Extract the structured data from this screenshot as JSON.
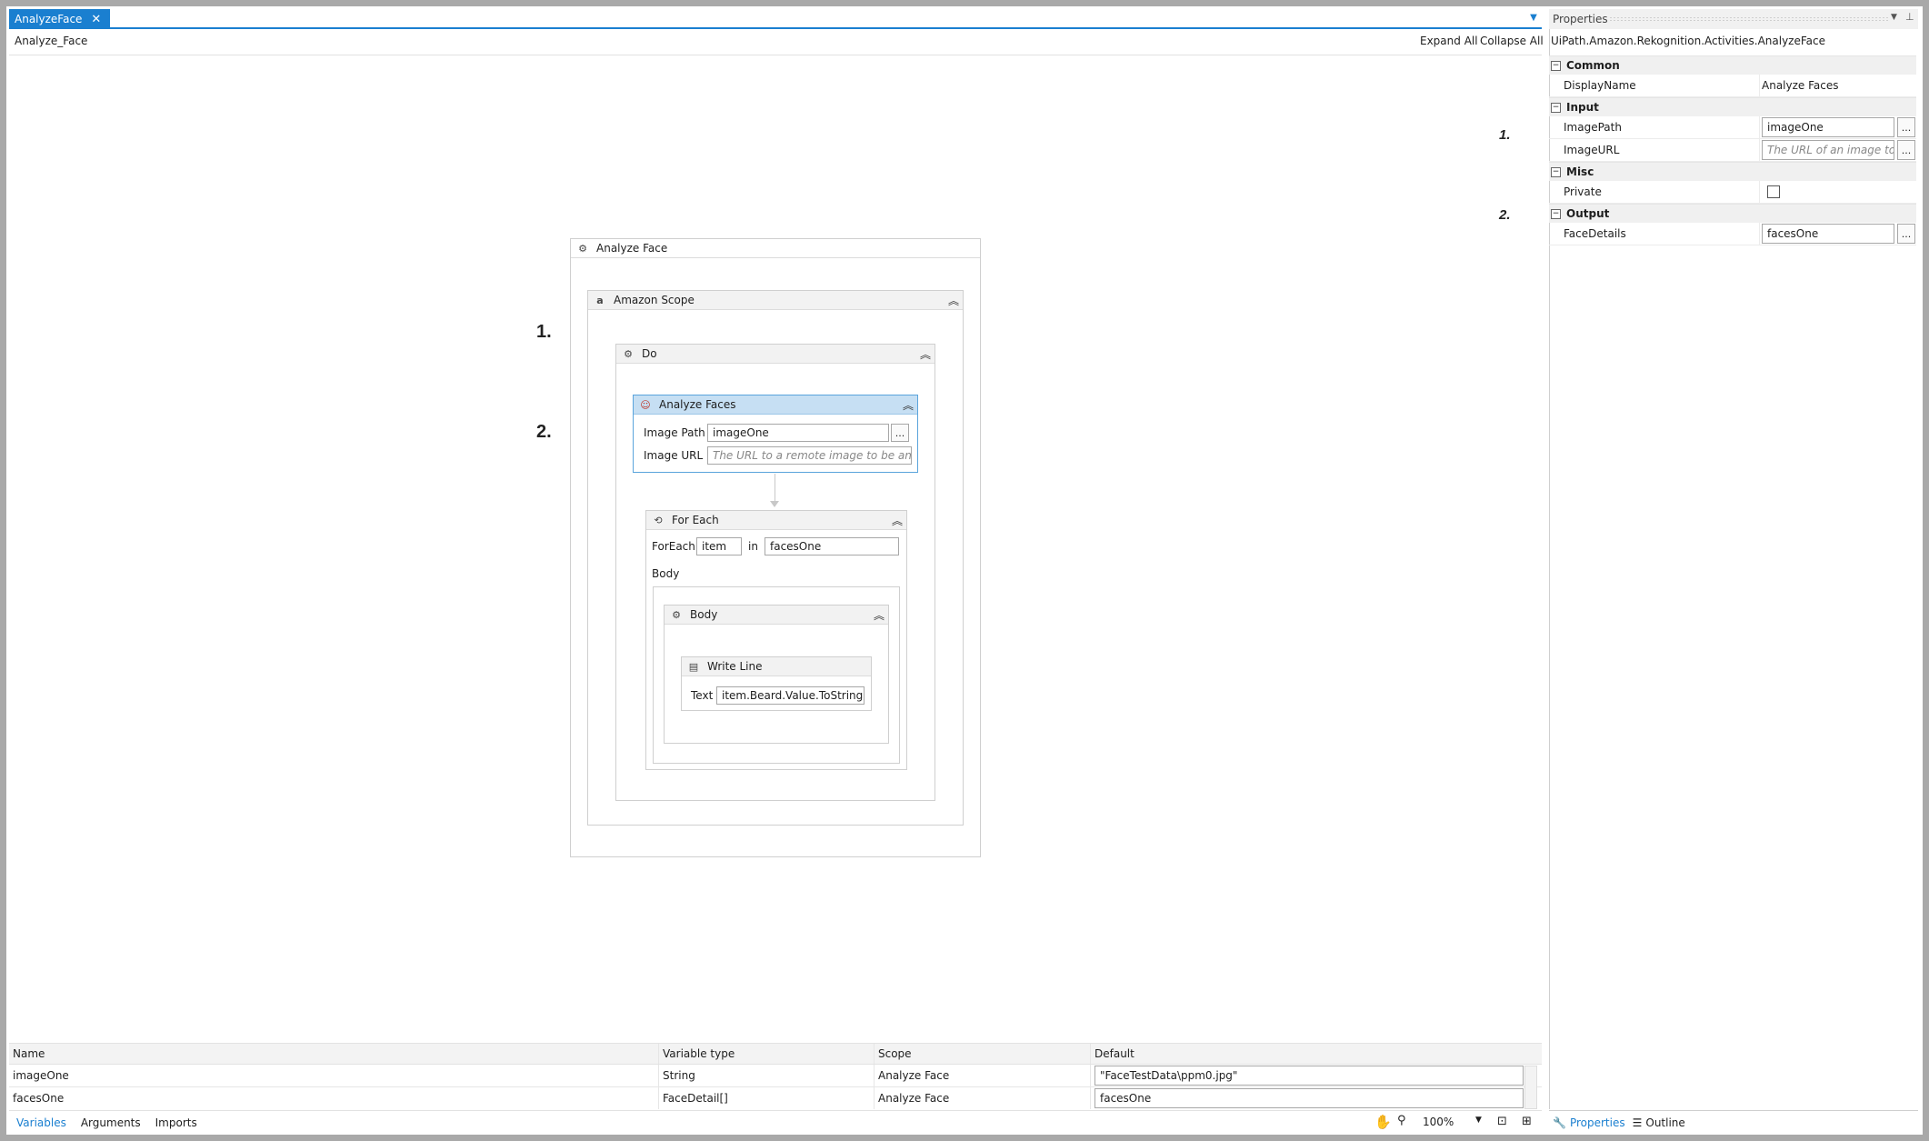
{
  "document": {
    "tab_title": "AnalyzeFace",
    "close_glyph": "✕",
    "breadcrumb": "Analyze_Face",
    "expand_all": "Expand All",
    "collapse_all": "Collapse All"
  },
  "markers": {
    "one": "1.",
    "two": "2."
  },
  "designer": {
    "analyze_face_sequence": "Analyze Face",
    "amazon_scope": "Amazon Scope",
    "amazon_scope_icon": "a",
    "do_sequence": "Do",
    "analyze_faces": {
      "title": "Analyze Faces",
      "image_path_label": "Image Path",
      "image_path_value": "imageOne",
      "image_url_label": "Image URL",
      "image_url_placeholder": "The URL to a remote image to be analyse",
      "browse": "..."
    },
    "for_each": {
      "title": "For Each",
      "foreach_label": "ForEach",
      "item_value": "item",
      "in_label": "in",
      "collection_value": "facesOne",
      "body_label": "Body"
    },
    "body_sequence": "Body",
    "write_line": {
      "title": "Write Line",
      "text_label": "Text",
      "text_value": "item.Beard.Value.ToString"
    }
  },
  "variables": {
    "columns": [
      "Name",
      "Variable type",
      "Scope",
      "Default"
    ],
    "rows": [
      {
        "name": "imageOne",
        "type": "String",
        "scope": "Analyze Face",
        "default": "\"FaceTestData\\ppm0.jpg\""
      },
      {
        "name": "facesOne",
        "type": "FaceDetail[]",
        "scope": "Analyze Face",
        "default": "facesOne"
      }
    ],
    "tabs": [
      "Variables",
      "Arguments",
      "Imports"
    ],
    "zoom": "100%"
  },
  "properties": {
    "title": "Properties",
    "activity_type": "UiPath.Amazon.Rekognition.Activities.AnalyzeFace",
    "categories": {
      "common": "Common",
      "input": "Input",
      "misc": "Misc",
      "output": "Output"
    },
    "display_name_label": "DisplayName",
    "display_name_value": "Analyze Faces",
    "image_path_label": "ImagePath",
    "image_path_value": "imageOne",
    "image_url_label": "ImageURL",
    "image_url_placeholder": "The URL of an image to",
    "private_label": "Private",
    "face_details_label": "FaceDetails",
    "face_details_value": "facesOne",
    "browse": "...",
    "collapse_glyph": "⊟",
    "bottom_tabs": [
      "Properties",
      "Outline"
    ]
  }
}
